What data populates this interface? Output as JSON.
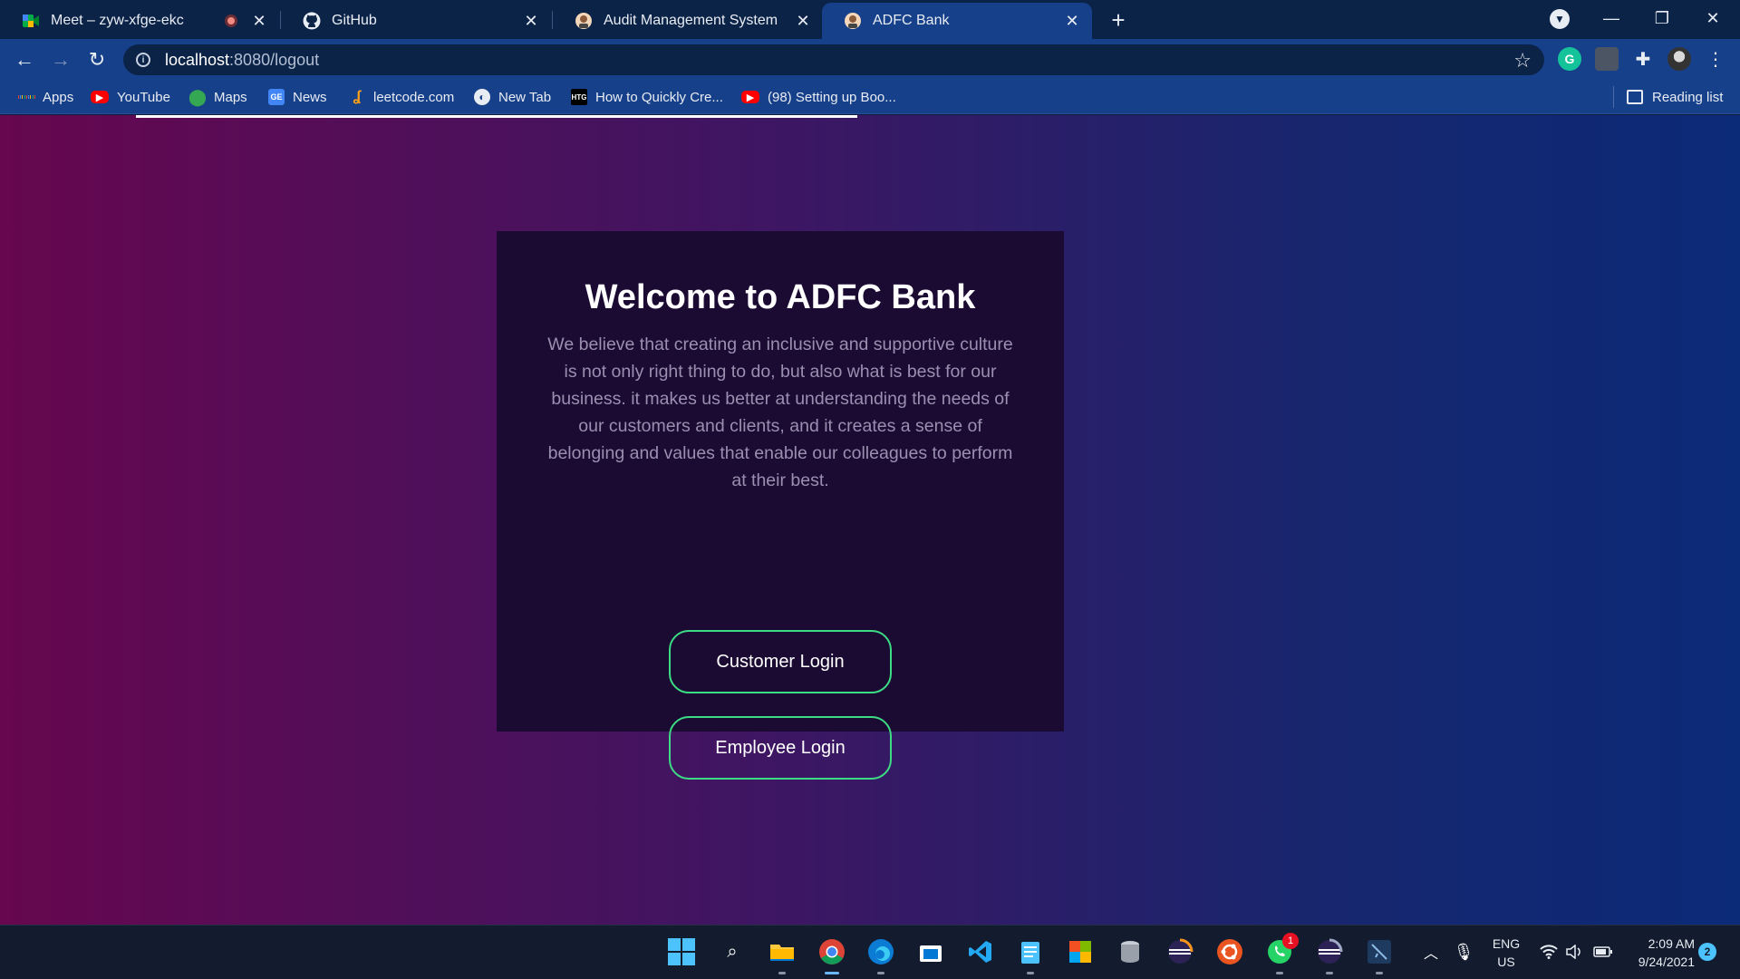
{
  "browser": {
    "tabs": [
      {
        "title": "Meet – zyw-xfge-ekc",
        "icon": "google-meet-icon",
        "recording": true
      },
      {
        "title": "GitHub",
        "icon": "github-icon"
      },
      {
        "title": "Audit Management System",
        "icon": "avatar-favicon"
      },
      {
        "title": "ADFC Bank",
        "icon": "avatar-favicon",
        "active": true
      }
    ],
    "new_tab_symbol": "+",
    "close_symbol": "✕",
    "address": {
      "host": "localhost",
      "path": ":8080/logout"
    },
    "bookmarks": [
      {
        "label": "Apps",
        "icon": "apps-grid-icon"
      },
      {
        "label": "YouTube",
        "icon": "youtube-icon"
      },
      {
        "label": "Maps",
        "icon": "maps-pin-icon"
      },
      {
        "label": "News",
        "icon": "google-news-icon"
      },
      {
        "label": "leetcode.com",
        "icon": "leetcode-icon"
      },
      {
        "label": "New Tab",
        "icon": "globe-icon"
      },
      {
        "label": "How to Quickly Cre...",
        "icon": "htg-icon"
      },
      {
        "label": "(98) Setting up Boo...",
        "icon": "youtube-icon"
      }
    ],
    "reading_list": "Reading list",
    "colors": {
      "frame": "#0c2348",
      "toolbar": "#17408a"
    }
  },
  "page": {
    "title": "Welcome to ADFC Bank",
    "description": "We believe that creating an inclusive and supportive culture is not only right thing to do, but also what is best for our business. it makes us better at understanding the needs of our customers and clients, and it creates a sense of belonging and values that enable our colleagues to perform at their best.",
    "buttons": {
      "customer": "Customer Login",
      "employee": "Employee Login"
    },
    "colors": {
      "card": "#1b0b33",
      "button_border": "#3cdc84",
      "text_muted": "#9b8fb0"
    }
  },
  "taskbar": {
    "apps": [
      "windows-start-icon",
      "search-icon",
      "file-explorer-icon",
      "chrome-icon",
      "edge-icon",
      "store-icon",
      "vscode-icon",
      "notepad-icon",
      "office-icon",
      "database-icon",
      "eclipse-icon",
      "ubuntu-icon",
      "whatsapp-icon",
      "eclipse-icon",
      "mysql-workbench-icon"
    ],
    "whatsapp_badge": "1",
    "language": {
      "line1": "ENG",
      "line2": "US"
    },
    "time": "2:09 AM",
    "date": "9/24/2021",
    "notifications": "2"
  }
}
